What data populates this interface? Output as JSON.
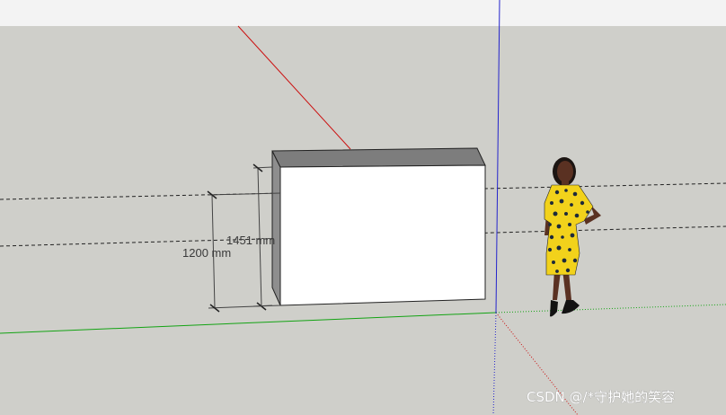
{
  "viewport": {
    "sky_color": "#f3f3f3",
    "ground_color": "#cfcfca"
  },
  "axes": {
    "red_color": "#cc1111",
    "green_color": "#13a313",
    "blue_color": "#2424cc"
  },
  "box": {
    "front_color": "#ffffff",
    "top_color": "#7d7d7d",
    "side_color": "#8e8e8e"
  },
  "dimensions": [
    {
      "id": "dim-1451",
      "label": "1451 mm"
    },
    {
      "id": "dim-1200",
      "label": "1200 mm"
    }
  ],
  "figure": {
    "dress_color": "#f2d21b",
    "skin_color": "#5a3122"
  },
  "watermark": {
    "text": "CSDN @/*守护她的笑容"
  }
}
